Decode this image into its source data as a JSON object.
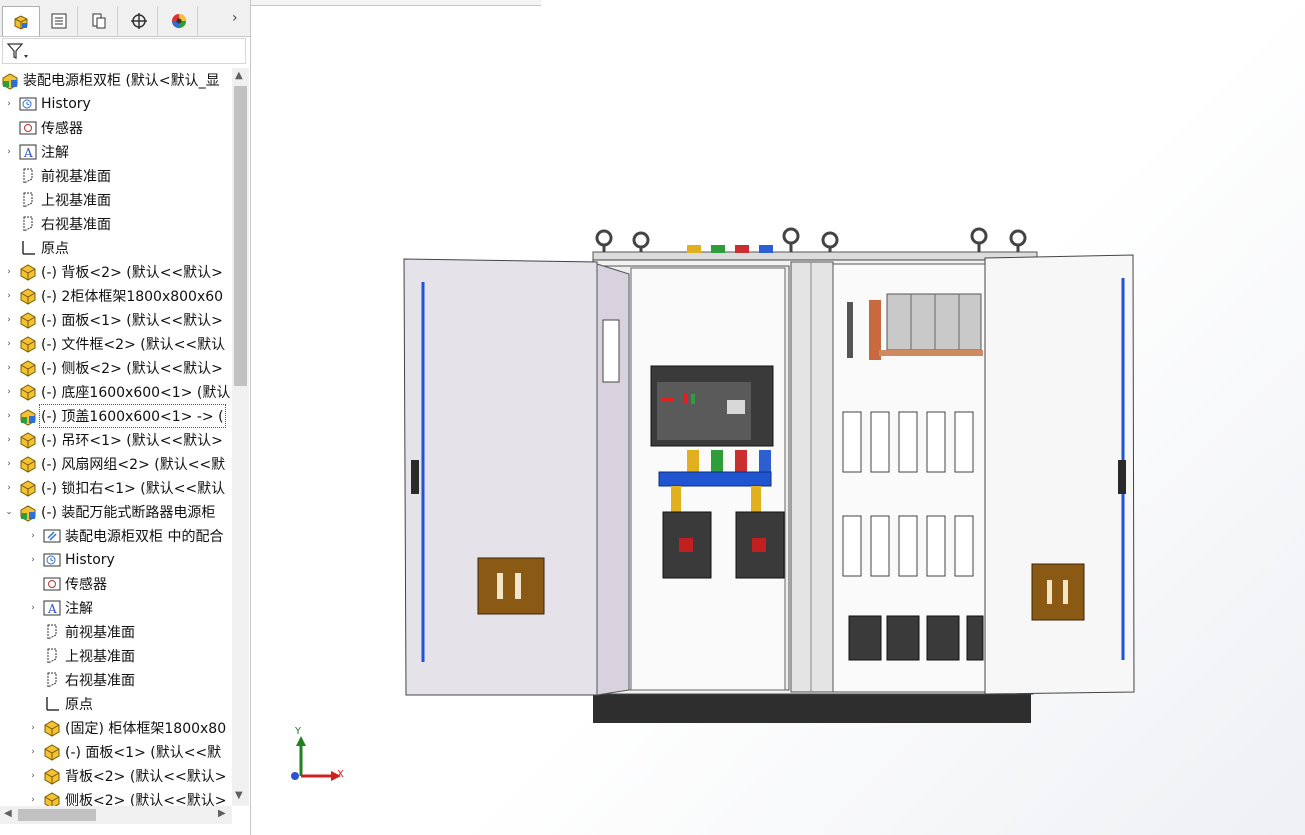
{
  "tabs": [
    {
      "name": "feature-manager",
      "icon": "feature-tree-icon"
    },
    {
      "name": "property-manager",
      "icon": "property-list-icon"
    },
    {
      "name": "configuration-manager",
      "icon": "configuration-icon"
    },
    {
      "name": "dimxpert-manager",
      "icon": "crosshair-icon"
    },
    {
      "name": "display-manager",
      "icon": "color-wheel-icon"
    }
  ],
  "tab_more": "›",
  "filter_icon": "filter-icon",
  "tree": {
    "root": "装配电源柜双柜  (默认<默认_显",
    "items": [
      {
        "level": 1,
        "expand": "›",
        "icon": "history-icon",
        "label": "History"
      },
      {
        "level": 1,
        "expand": "",
        "icon": "sensor-icon",
        "label": "传感器"
      },
      {
        "level": 1,
        "expand": "›",
        "icon": "annotation-icon",
        "label": "注解"
      },
      {
        "level": 1,
        "expand": "",
        "icon": "plane-icon",
        "label": "前视基准面"
      },
      {
        "level": 1,
        "expand": "",
        "icon": "plane-icon",
        "label": "上视基准面"
      },
      {
        "level": 1,
        "expand": "",
        "icon": "plane-icon",
        "label": "右视基准面"
      },
      {
        "level": 1,
        "expand": "",
        "icon": "origin-icon",
        "label": "原点"
      },
      {
        "level": 1,
        "expand": "›",
        "icon": "part-icon",
        "label": "(-) 背板<2> (默认<<默认>"
      },
      {
        "level": 1,
        "expand": "›",
        "icon": "part-icon",
        "label": "(-) 2柜体框架1800x800x60"
      },
      {
        "level": 1,
        "expand": "›",
        "icon": "part-icon",
        "label": "(-) 面板<1> (默认<<默认>"
      },
      {
        "level": 1,
        "expand": "›",
        "icon": "part-icon",
        "label": "(-) 文件框<2> (默认<<默认"
      },
      {
        "level": 1,
        "expand": "›",
        "icon": "part-icon",
        "label": "(-) 侧板<2> (默认<<默认>"
      },
      {
        "level": 1,
        "expand": "›",
        "icon": "part-icon",
        "label": "(-) 底座1600x600<1> (默认"
      },
      {
        "level": 1,
        "expand": "›",
        "icon": "assembly-icon",
        "label": "(-) 顶盖1600x600<1> -> (",
        "selected": true
      },
      {
        "level": 1,
        "expand": "›",
        "icon": "part-icon",
        "label": "(-) 吊环<1> (默认<<默认>"
      },
      {
        "level": 1,
        "expand": "›",
        "icon": "part-icon",
        "label": "(-) 风扇网组<2> (默认<<默"
      },
      {
        "level": 1,
        "expand": "›",
        "icon": "part-icon",
        "label": "(-) 锁扣右<1> (默认<<默认"
      },
      {
        "level": 1,
        "expand": "⌄",
        "icon": "assembly-icon",
        "label": "(-) 装配万能式断路器电源柜"
      },
      {
        "level": 2,
        "expand": "›",
        "icon": "mates-icon",
        "label": "装配电源柜双柜 中的配合"
      },
      {
        "level": 2,
        "expand": "›",
        "icon": "history-icon",
        "label": "History"
      },
      {
        "level": 2,
        "expand": "",
        "icon": "sensor-icon",
        "label": "传感器"
      },
      {
        "level": 2,
        "expand": "›",
        "icon": "annotation-icon",
        "label": "注解"
      },
      {
        "level": 2,
        "expand": "",
        "icon": "plane-icon",
        "label": "前视基准面"
      },
      {
        "level": 2,
        "expand": "",
        "icon": "plane-icon",
        "label": "上视基准面"
      },
      {
        "level": 2,
        "expand": "",
        "icon": "plane-icon",
        "label": "右视基准面"
      },
      {
        "level": 2,
        "expand": "",
        "icon": "origin-icon",
        "label": "原点"
      },
      {
        "level": 2,
        "expand": "›",
        "icon": "part-icon",
        "label": "(固定) 柜体框架1800x80"
      },
      {
        "level": 2,
        "expand": "›",
        "icon": "part-icon",
        "label": "(-) 面板<1> (默认<<默"
      },
      {
        "level": 2,
        "expand": "›",
        "icon": "part-icon",
        "label": "背板<2> (默认<<默认>"
      },
      {
        "level": 2,
        "expand": "›",
        "icon": "part-icon",
        "label": "侧板<2> (默认<<默认>"
      }
    ]
  },
  "triad": {
    "x_label": "X",
    "y_label": "Y"
  },
  "colors": {
    "panel_bg": "#ffffff",
    "tab_bg": "#f0f0f0",
    "part_yellow": "#f3c233",
    "door_fill": "#e6e2ea",
    "cabinet_white": "#f7f7f7",
    "base_dark": "#333333",
    "handle_brown": "#8a5a14",
    "busbar_blue": "#1f55d0"
  }
}
